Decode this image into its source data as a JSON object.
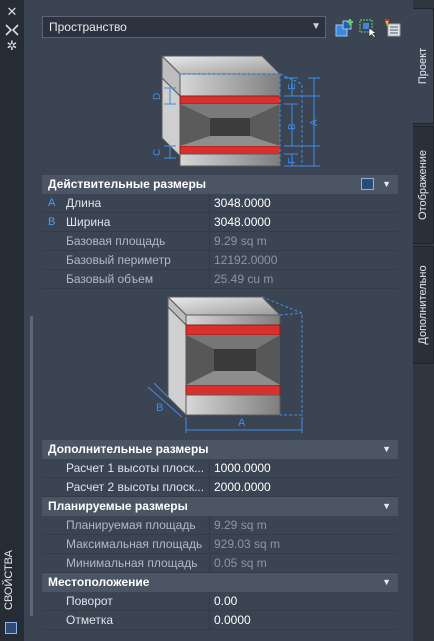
{
  "palette": {
    "title": "СВОЙСТВА",
    "icons": [
      "close-icon",
      "auto-hide-icon",
      "settings-icon"
    ]
  },
  "toolbar": {
    "object_type": "Пространство",
    "buttons": [
      "add-to-selection-icon",
      "select-objects-icon",
      "quick-select-icon"
    ]
  },
  "diagrams": {
    "top_labels": [
      "D",
      "E",
      "B",
      "A",
      "C",
      "F"
    ],
    "bottom_labels": [
      "B",
      "A"
    ]
  },
  "sections": {
    "actual": {
      "title": "Действительные размеры",
      "rows": [
        {
          "marker": "A",
          "name": "Длина",
          "value": "3048.0000",
          "editable": true
        },
        {
          "marker": "B",
          "name": "Ширина",
          "value": "3048.0000",
          "editable": true
        },
        {
          "marker": "",
          "name": "Базовая площадь",
          "value": "9.29 sq m",
          "editable": false
        },
        {
          "marker": "",
          "name": "Базовый периметр",
          "value": "12192.0000",
          "editable": false
        },
        {
          "marker": "",
          "name": "Базовый объем",
          "value": "25.49  cu m",
          "editable": false
        }
      ]
    },
    "additional": {
      "title": "Дополнительные размеры",
      "rows": [
        {
          "name": "Расчет 1 высоты плоск...",
          "value": "1000.0000"
        },
        {
          "name": "Расчет 2 высоты плоск...",
          "value": "2000.0000"
        }
      ]
    },
    "planned": {
      "title": "Планируемые размеры",
      "rows": [
        {
          "name": "Планируемая площадь",
          "value": "9.29 sq m"
        },
        {
          "name": "Максимальная площадь",
          "value": "929.03 sq m"
        },
        {
          "name": "Минимальная площадь",
          "value": "0.05 sq m"
        }
      ]
    },
    "location": {
      "title": "Местоположение",
      "rows": [
        {
          "name": "Поворот",
          "value": "0.00"
        },
        {
          "name": "Отметка",
          "value": "0.0000"
        }
      ]
    }
  },
  "tabs": [
    "Проект",
    "Отображение",
    "Дополнительно"
  ],
  "colors": {
    "accent": "#4f9cf0",
    "wall_red": "#d9302c",
    "dim_line": "#3d8ee8"
  }
}
